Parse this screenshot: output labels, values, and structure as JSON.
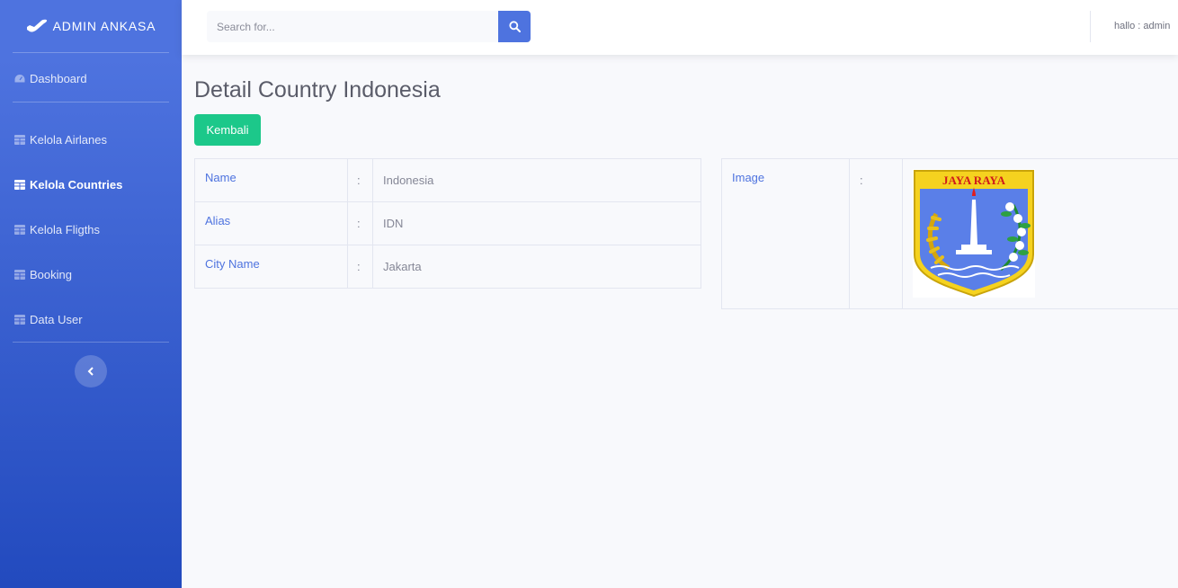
{
  "brand": {
    "title": "ADMIN ANKASA",
    "icon": "plane-icon"
  },
  "sidebar": {
    "items": [
      {
        "label": "Dashboard",
        "icon": "tachometer-icon"
      },
      {
        "label": "Kelola Airlanes",
        "icon": "table-icon"
      },
      {
        "label": "Kelola Countries",
        "icon": "table-icon",
        "active": true
      },
      {
        "label": "Kelola Fligths",
        "icon": "table-icon"
      },
      {
        "label": "Booking",
        "icon": "table-icon"
      },
      {
        "label": "Data User",
        "icon": "table-icon"
      }
    ],
    "toggle_icon": "chevron-left-icon"
  },
  "topbar": {
    "search_placeholder": "Search for...",
    "search_icon": "search-icon",
    "user_text": "hallo : admin"
  },
  "page": {
    "title": "Detail Country Indonesia",
    "back_label": "Kembali"
  },
  "details": [
    {
      "key": "Name",
      "sep": ":",
      "value": "Indonesia"
    },
    {
      "key": "Alias",
      "sep": ":",
      "value": "IDN"
    },
    {
      "key": "City Name",
      "sep": ":",
      "value": "Jakarta"
    }
  ],
  "image_row": {
    "key": "Image",
    "sep": ":",
    "emblem_text": "JAYA RAYA"
  },
  "colors": {
    "primary": "#4e73df",
    "success": "#1cc88a",
    "text": "#858796",
    "heading": "#5a5c69"
  }
}
